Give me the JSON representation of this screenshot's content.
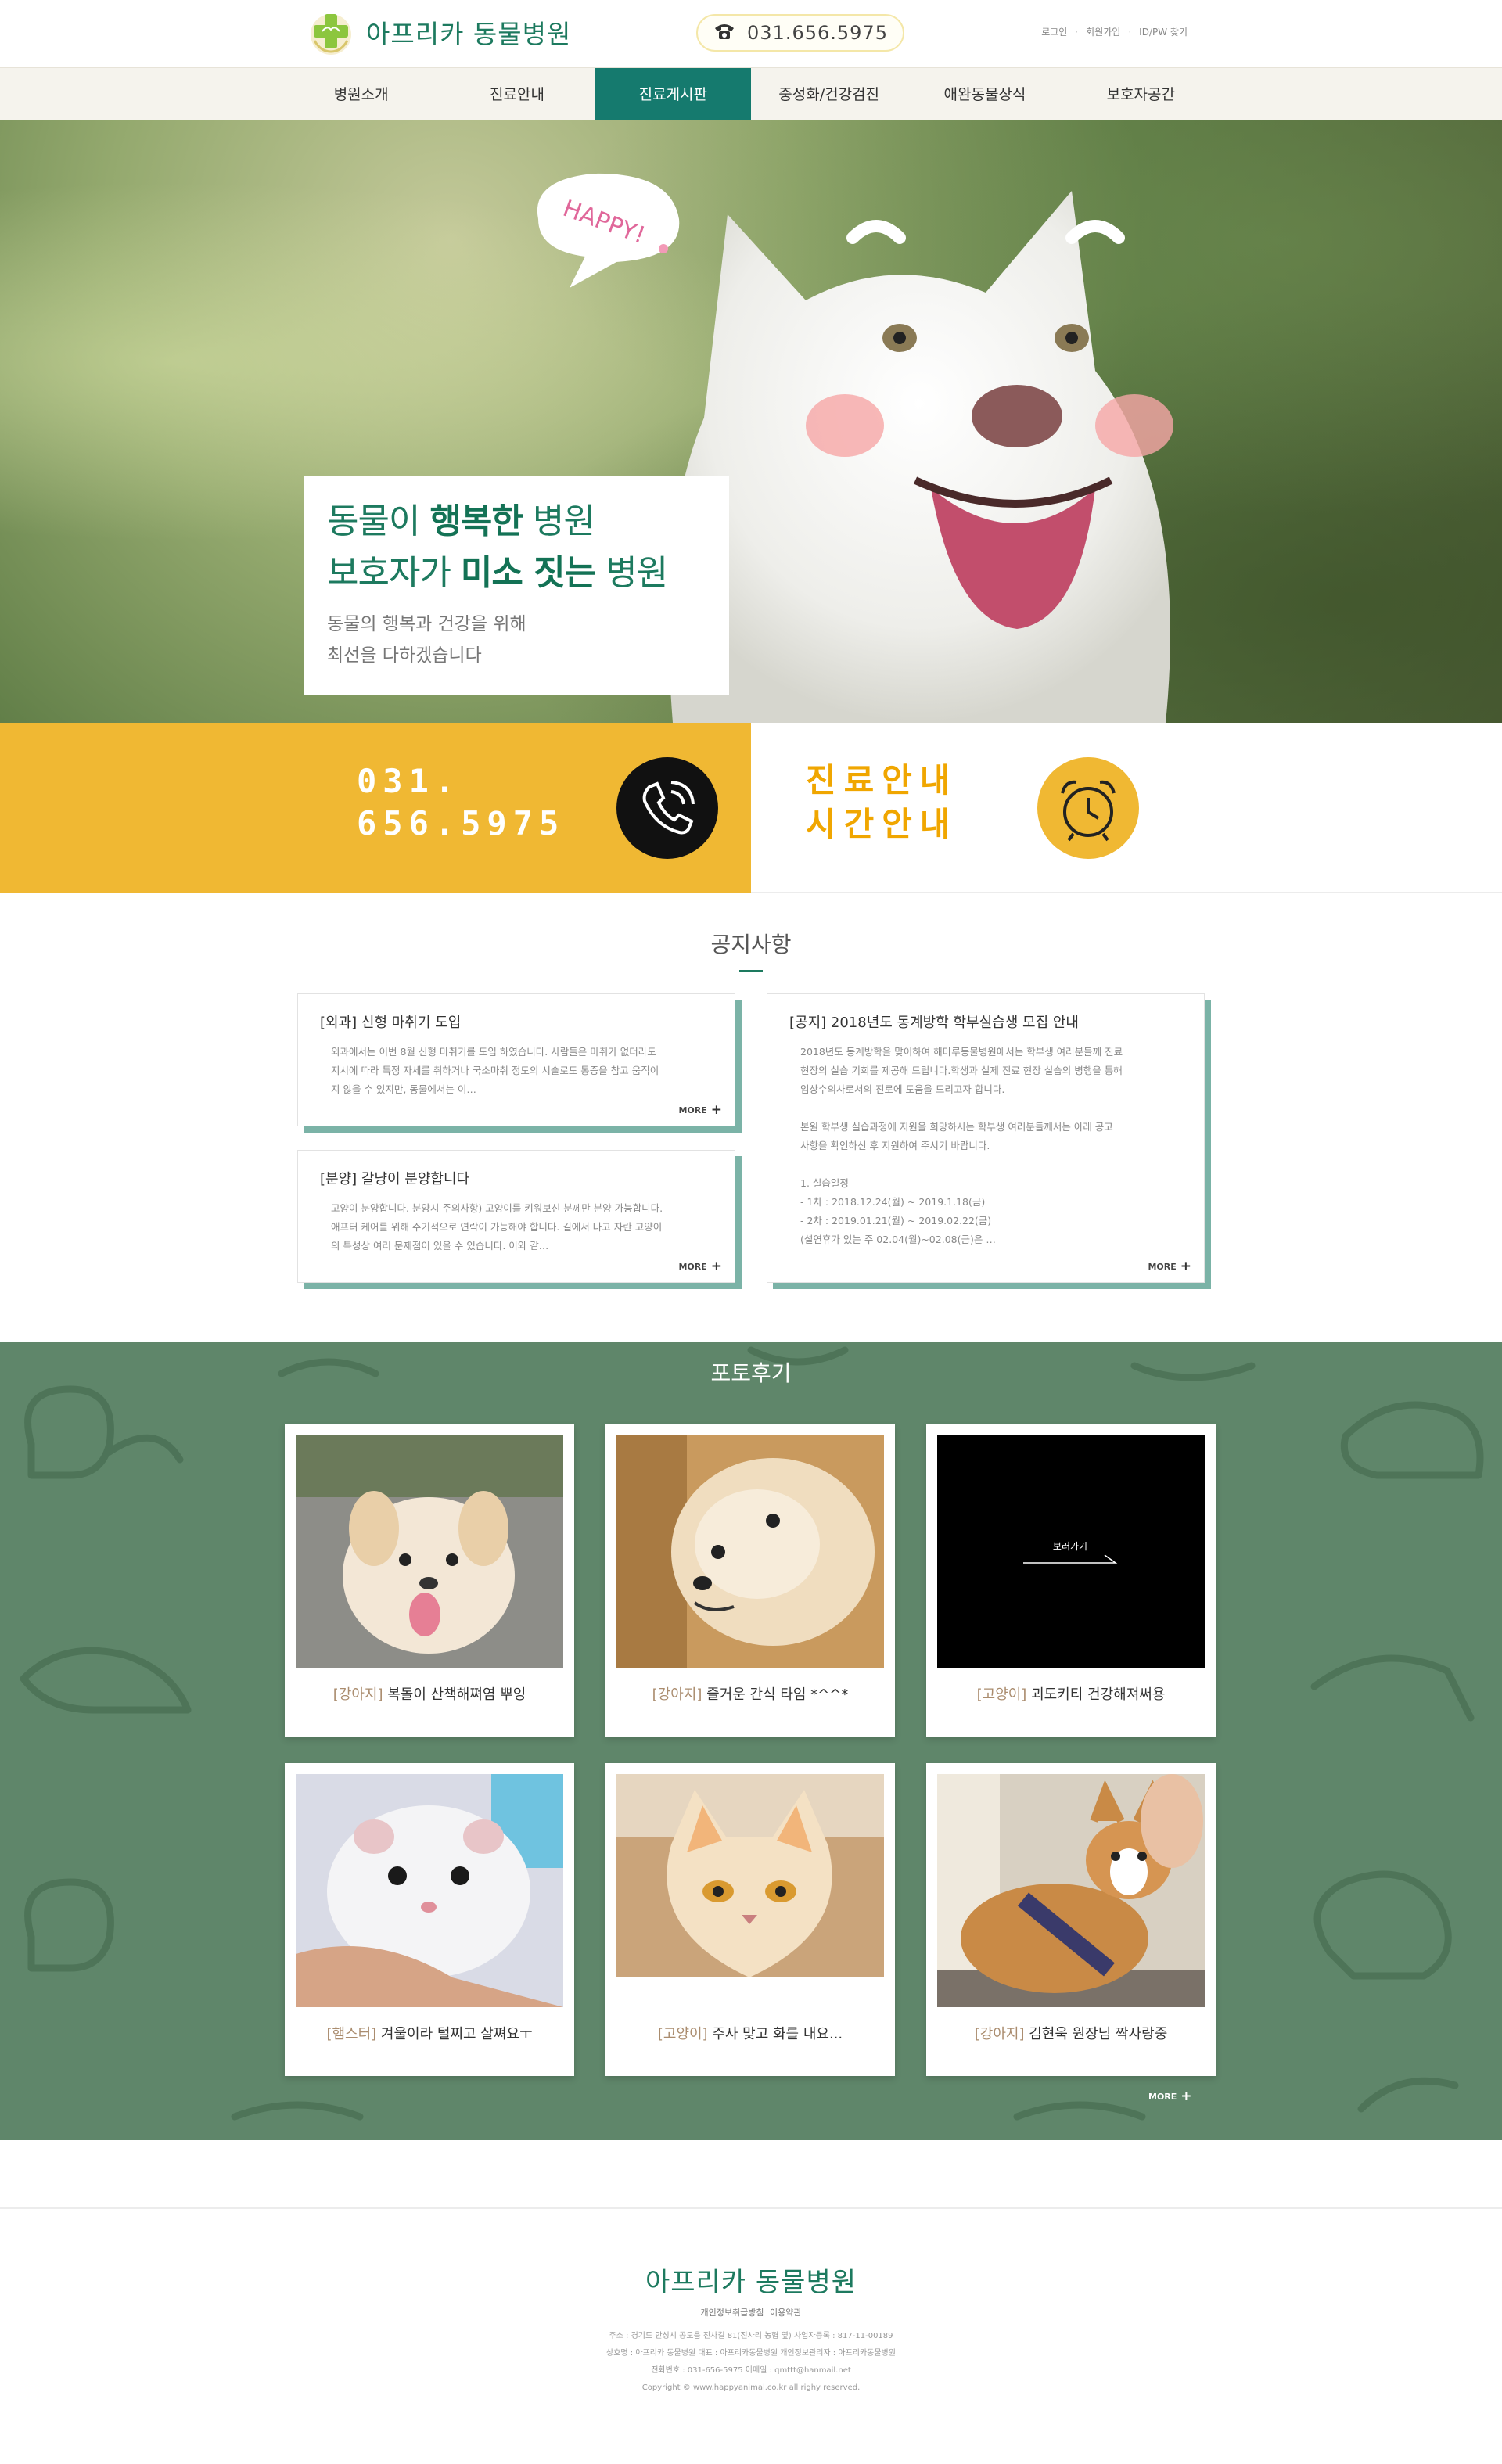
{
  "brand": {
    "name": "아프리카 동물병원",
    "accent": "#1d7a5f",
    "yellow": "#f0b833",
    "green_bg": "#5f866a"
  },
  "header": {
    "phone": "031.656.5975",
    "util_links": [
      "로그인",
      "회원가입",
      "ID/PW 찾기"
    ]
  },
  "nav": {
    "items": [
      "병원소개",
      "진료안내",
      "진료게시판",
      "중성화/건강검진",
      "애완동물상식",
      "보호자공간"
    ],
    "active": "진료게시판"
  },
  "hero": {
    "bubble": "HAPPY!",
    "line1_pre": "동물이 ",
    "line1_bold": "행복한",
    "line1_post": " 병원",
    "line2_pre": "보호자가 ",
    "line2_bold": "미소 짓는",
    "line2_post": " 병원",
    "sub1": "동물의 행복과 건강을 위해",
    "sub2": "최선을 다하겠습니다"
  },
  "band": {
    "phone_line1": "031.",
    "phone_line2": "656.5975",
    "phone_icon": "phone-ringing-icon",
    "title_line1": "진료안내",
    "title_line2": "시간안내",
    "clock_icon": "alarm-clock-icon"
  },
  "notice": {
    "title": "공지사항",
    "more": "MORE",
    "cards": [
      {
        "title": "[외과] 신형 마취기 도입",
        "body": "외과에서는 이번 8월 신형 마취기를 도입 하였습니다. 사람들은 마취가 없더라도\n지시에 따라 특정 자세를 취하거나 국소마취 정도의 시술로도 통증을 참고 움직이\n지 않을 수 있지만, 동물에서는 이…"
      },
      {
        "title": "[분양] 갈냥이 분양합니다",
        "body": "고양이 분양합니다. 분양시 주의사항) 고양이를 키워보신 분께만 분양 가능합니다.\n애프터 케어를 위해 주기적으로 연락이 가능해야 합니다. 길에서 나고 자란 고양이\n의 특성상 여러 문제점이 있을 수 있습니다. 이와 같…"
      },
      {
        "title": "[공지] 2018년도 동계방학 학부실습생 모집 안내",
        "body": "2018년도 동계방학을 맞이하여 해마루동물병원에서는 학부생 여러분들께 진료\n현장의 실습 기회를 제공해 드립니다.학생과 실제 진료 현장 실습의 병행을 통해\n임상수의사로서의 진로에 도움을 드리고자 합니다.\n\n본원 학부생 실습과정에 지원을 희망하시는 학부생 여러분들께서는 아래 공고\n사항을 확인하신 후 지원하여 주시기 바랍니다.\n\n1. 실습일정\n - 1차 : 2018.12.24(월) ~ 2019.1.18(금)\n - 2차 : 2019.01.21(월) ~ 2019.02.22(금)\n  (설연휴가 있는 주 02.04(월)~02.08(금)은 …"
      }
    ]
  },
  "photos": {
    "title": "포토후기",
    "more": "MORE",
    "view_label": "보러가기",
    "items": [
      {
        "tag": "[강아지]",
        "text": " 복돌이 산책해쪄염 뿌잉"
      },
      {
        "tag": "[강아지]",
        "text": " 즐거운 간식 타임 *^^*"
      },
      {
        "tag": "[고양이]",
        "text": " 괴도키티 건강해져써용"
      },
      {
        "tag": "[햄스터]",
        "text": " 겨울이라 털찌고 살쪄요ㅜ"
      },
      {
        "tag": "[고양이]",
        "text": " 주사 맞고 화를 내요..."
      },
      {
        "tag": "[강아지]",
        "text": " 김현욱 원장님 짝사랑중"
      }
    ]
  },
  "footer": {
    "logo": "아프리카 동물병원",
    "links": "개인정보취급방침    이용약관",
    "info1": "주소 : 경기도 안성시 공도읍 진사길 81(진사리 농협 옆)        사업자등록 : 817-11-00189",
    "info2": "상호명 : 아프리카 동물병원        대표 : 아프리카동물병원        개인정보관리자 : 아프리카동물병원",
    "info3": "전화번호 : 031-656-5975        이메일 : qmttt@hanmail.net",
    "info4": "Copyright © www.happyanimal.co.kr all righy reserved."
  }
}
